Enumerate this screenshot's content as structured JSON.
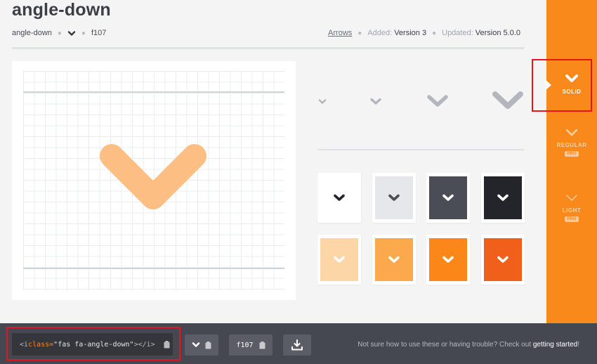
{
  "icon": {
    "title": "angle-down",
    "name": "angle-down",
    "unicode": "f107",
    "category": "Arrows",
    "added_label": "Added:",
    "added_value": "Version 3",
    "updated_label": "Updated:",
    "updated_value": "Version 5.0.0"
  },
  "styles": [
    {
      "label": "SOLID",
      "pro": "",
      "selected": true
    },
    {
      "label": "REGULAR",
      "pro": "PRO",
      "selected": false
    },
    {
      "label": "LIGHT",
      "pro": "PRO",
      "selected": false
    }
  ],
  "swatches": {
    "row1": [
      "#ffffff",
      "#e6e7ea",
      "#4a4d55",
      "#23252b"
    ],
    "row2": [
      "#fdd6a8",
      "#fca84c",
      "#fb8718",
      "#f0601a"
    ]
  },
  "colors": {
    "accent": "#fa891b",
    "big_icon": "#fdbe84",
    "size_icons": "#b3b6bc"
  },
  "bottom": {
    "code_open": "<i ",
    "code_attr": "class=",
    "code_value": "\"fas fa-angle-down\"",
    "code_close": "></i>",
    "unicode_btn": "f107",
    "help_text": "Not sure how to use these or having trouble? Check out ",
    "help_link": "getting started",
    "help_end": "!"
  }
}
